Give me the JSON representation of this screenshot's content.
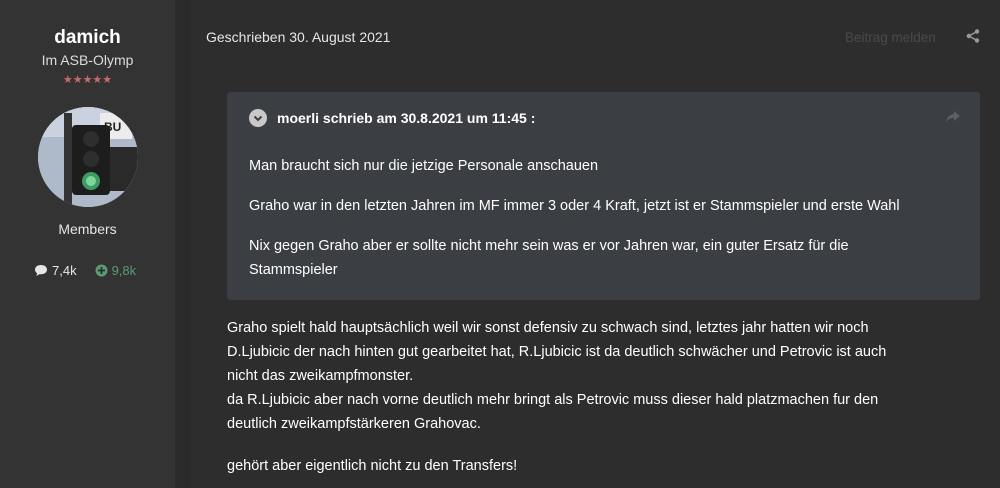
{
  "author": {
    "username": "damich",
    "title": "Im ASB-Olymp",
    "stars": "★★★★★",
    "group": "Members",
    "posts_count": "7,4k",
    "reputation": "9,8k"
  },
  "post": {
    "posted_label": "Geschrieben 30. August 2021",
    "report_label": "Beitrag melden",
    "quote": {
      "header": "moerli schrieb am 30.8.2021 um 11:45 :",
      "lines": [
        "Man braucht sich nur die jetzige Personale anschauen",
        "Graho war in den letzten Jahren im MF immer 3 oder 4 Kraft, jetzt ist er Stammspieler und erste Wahl",
        "Nix gegen Graho aber er sollte nicht mehr sein was er vor Jahren war, ein guter Ersatz für die",
        "Stammspieler"
      ]
    },
    "body_lines": [
      "Graho spielt hald hauptsächlich weil wir sonst defensiv zu schwach sind, letztes jahr hatten wir noch",
      "D.Ljubicic der nach hinten gut gearbeitet hat, R.Ljubicic ist da deutlich schwächer und Petrovic ist auch",
      "nicht das zweikampfmonster.",
      "da R.Ljubicic aber nach vorne deutlich mehr bringt als Petrovic muss dieser hald platzmachen fur den",
      "deutlich zweikampfstärkeren Grahovac.",
      "gehört aber eigentlich nicht zu den Transfers!"
    ]
  },
  "icons": {
    "share": "share-icon",
    "reply_share": "share-arrow-icon",
    "quote_toggle": "chevron-down-icon",
    "posts": "speech-bubble-icon",
    "reputation": "plus-circle-icon"
  },
  "colors": {
    "background": "#2b2b2b",
    "sidebar": "#333333",
    "quote_bg": "#3b3e43",
    "stars": "#c76b6b",
    "reputation": "#5b9a73"
  }
}
